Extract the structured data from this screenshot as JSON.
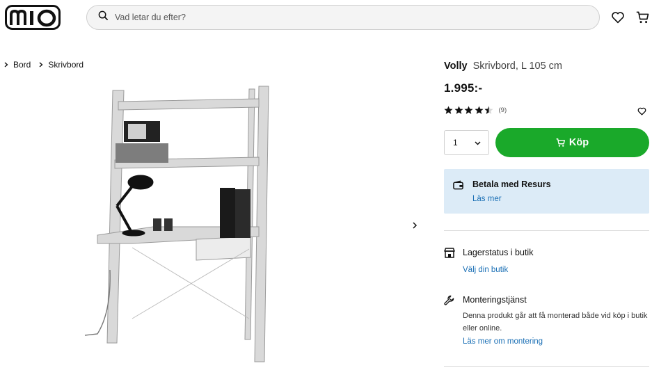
{
  "header": {
    "logo_text": "mio",
    "search_placeholder": "Vad letar du efter?",
    "icons": [
      "search-icon",
      "heart-icon",
      "cart-icon"
    ]
  },
  "breadcrumb": [
    {
      "label": "Bord"
    },
    {
      "label": "Skrivbord"
    }
  ],
  "product": {
    "brand": "Volly",
    "description": "Skrivbord, L 105 cm",
    "price": "1.995:-",
    "rating": {
      "value": 4.5,
      "max": 5,
      "count_label": "(9)"
    },
    "quantity": "1",
    "buy_label": "Köp"
  },
  "payment": {
    "title": "Betala med Resurs",
    "link": "Läs mer"
  },
  "stock": {
    "title": "Lagerstatus i butik",
    "link": "Välj din butik"
  },
  "assembly": {
    "title": "Monteringstjänst",
    "text": "Denna produkt går att få monterad både vid köp i butik eller online.",
    "link": "Läs mer om montering"
  },
  "colors": {
    "buy_green": "#1aa92a",
    "info_blue_bg": "#dcebf7",
    "link_blue": "#1a6fb5"
  }
}
